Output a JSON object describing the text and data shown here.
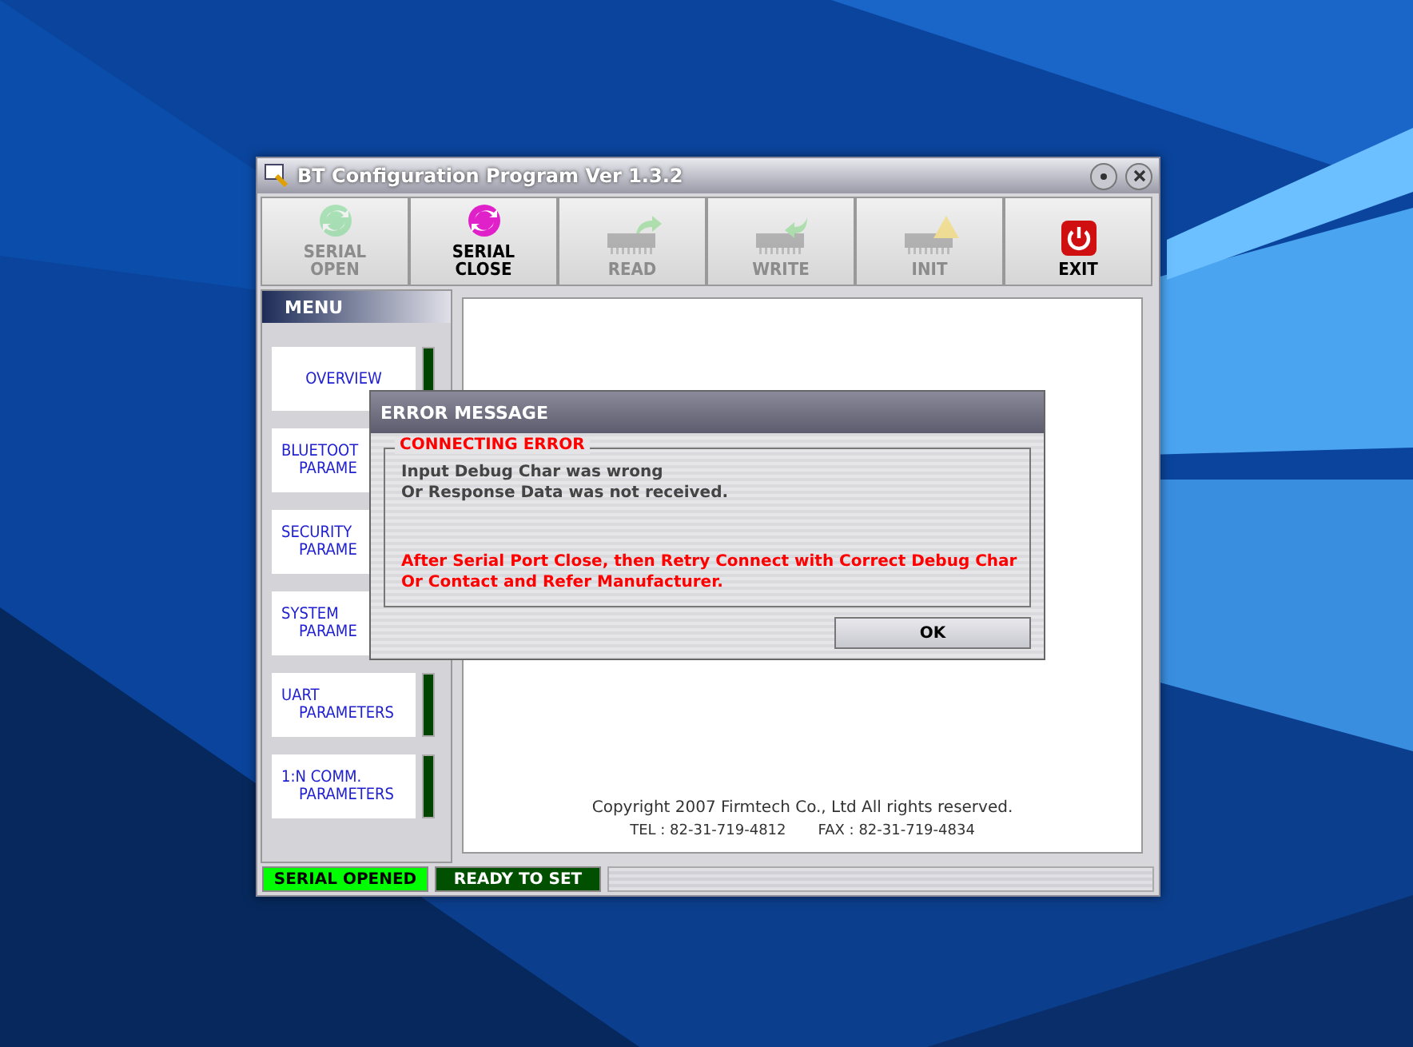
{
  "window": {
    "title": "BT Configuration Program Ver 1.3.2"
  },
  "toolbar": [
    {
      "kind": "sync-green",
      "label": [
        "SERIAL",
        "OPEN"
      ],
      "disabled": true
    },
    {
      "kind": "sync-pink",
      "label": [
        "SERIAL",
        "CLOSE"
      ],
      "disabled": false
    },
    {
      "kind": "chip-read",
      "label": [
        "READ"
      ],
      "disabled": true
    },
    {
      "kind": "chip-write",
      "label": [
        "WRITE"
      ],
      "disabled": true
    },
    {
      "kind": "chip-warning",
      "label": [
        "INIT"
      ],
      "disabled": true
    },
    {
      "kind": "power",
      "label": [
        "EXIT"
      ],
      "disabled": false
    }
  ],
  "menu": {
    "title": "MENU",
    "items": [
      {
        "lines": [
          "OVERVIEW"
        ],
        "indicator": true
      },
      {
        "lines": [
          "BLUETOOT",
          "PARAME"
        ],
        "indicator": false
      },
      {
        "lines": [
          "SECURITY",
          "PARAME"
        ],
        "indicator": false
      },
      {
        "lines": [
          "SYSTEM",
          "PARAME"
        ],
        "indicator": false
      },
      {
        "lines": [
          "UART",
          "PARAMETERS"
        ],
        "indicator": true
      },
      {
        "lines": [
          "1:N COMM.",
          "PARAMETERS"
        ],
        "indicator": true
      }
    ]
  },
  "content": {
    "copyright": "Copyright 2007 Firmtech Co., Ltd All rights reserved.",
    "tel": "TEL : 82-31-719-4812",
    "fax": "FAX : 82-31-719-4834"
  },
  "status_bar": [
    {
      "text": "SERIAL OPENED",
      "color": "#00ff00"
    },
    {
      "text": "READY TO SET",
      "color": "#005000"
    }
  ],
  "dialog": {
    "title": "ERROR MESSAGE",
    "group_title": "CONNECTING ERROR",
    "message": [
      "Input Debug Char was wrong",
      "Or Response Data was not received."
    ],
    "instruction": [
      "After Serial Port Close, then Retry Connect with Correct Debug Char",
      "Or Contact and Refer Manufacturer."
    ],
    "button": "OK"
  }
}
